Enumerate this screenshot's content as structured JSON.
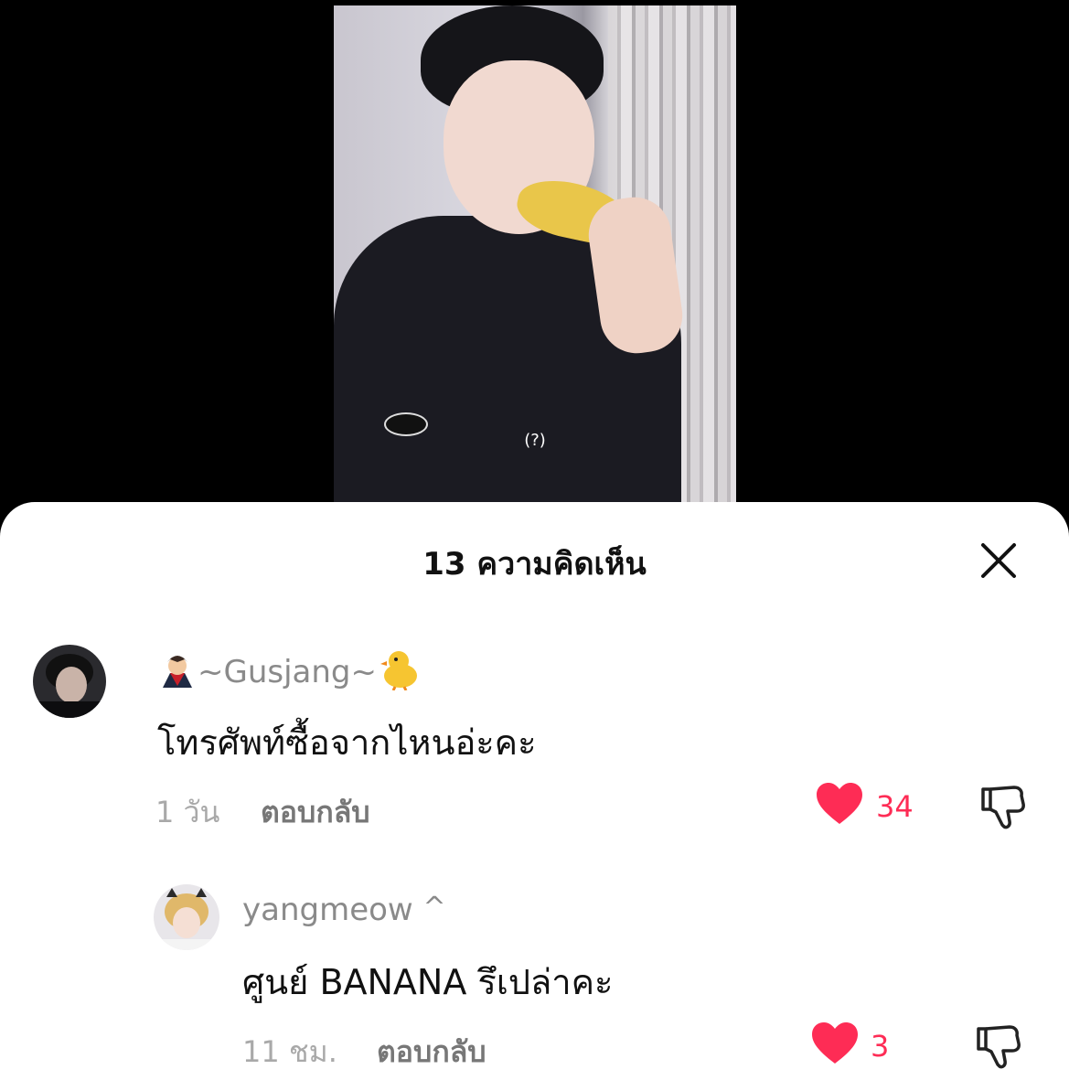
{
  "video": {
    "caption": "(?)"
  },
  "comments_panel": {
    "title": "13 ความคิดเห็น",
    "close_icon": "close-icon"
  },
  "comments": [
    {
      "username": "~Gusjang~",
      "username_emoji_left": "vampire-emoji",
      "username_emoji_right": "chick-emoji",
      "text": "โทรศัพท์ซื้อจากไหนอ่ะคะ",
      "time": "1 วัน",
      "reply_label": "ตอบกลับ",
      "likes": "34"
    },
    {
      "username": "yangmeow",
      "username_suffix": "^",
      "text": "ศูนย์ BANANA รึเปล่าคะ",
      "time": "11 ชม.",
      "reply_label": "ตอบกลับ",
      "likes": "3"
    }
  ],
  "colors": {
    "like": "#fe2c55",
    "muted": "#8a8a8a",
    "text": "#111111"
  }
}
